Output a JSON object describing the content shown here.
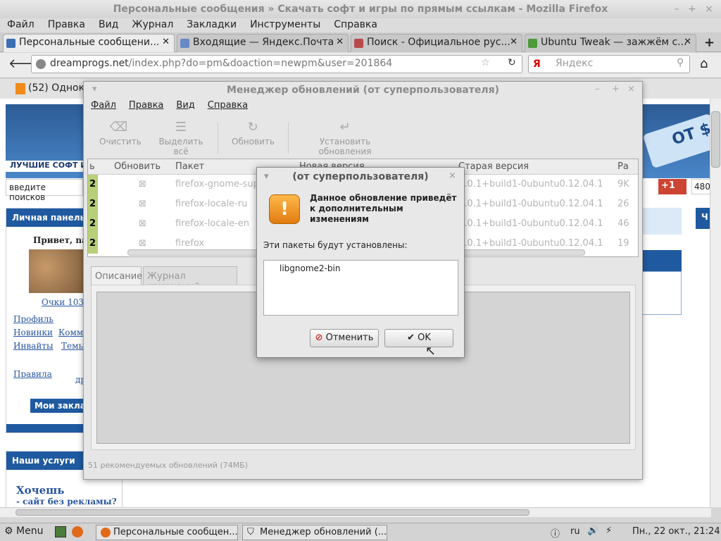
{
  "firefox": {
    "window_title": "Персональные сообщения » Скачать софт и игры по прямым ссылкам - Mozilla Firefox",
    "menu": [
      "Файл",
      "Правка",
      "Вид",
      "Журнал",
      "Закладки",
      "Инструменты",
      "Справка"
    ],
    "tabs": [
      {
        "label": "Персональные сообщени...",
        "active": true
      },
      {
        "label": "Входящие — Яндекс.Почта",
        "active": false
      },
      {
        "label": "Поиск - Официальное рус...",
        "active": false
      },
      {
        "label": "Ubuntu Tweak — зажжём с...",
        "active": false
      }
    ],
    "url_host": "dreamprogs.net",
    "url_path": "/index.php?do=pm&doaction=newpm&user=201864",
    "search_placeholder": "Яндекс",
    "bookmark": "(52) Однокл"
  },
  "page": {
    "header_tag": "ЛУЧШИЕ СОФТ И",
    "search_placeholder": "введите поисков",
    "badge_text": "OT $",
    "social_plus": "+1",
    "social_count": "480",
    "panel_title": "Личная панель",
    "greeting": "Привет, nayc",
    "glasses": "Очки 10378",
    "links": [
      "Профиль",
      "Новинки",
      "Комме",
      "Инвайты",
      "Темы",
      "Правила",
      "др"
    ],
    "bookmarks_btn": "Мои заклад",
    "services_title": "Наши услуги",
    "promo_title": "Хочешь",
    "promo_sub": "- сайт без рекламы?",
    "right_panel": "Ч"
  },
  "updater": {
    "title": "Менеджер обновлений (от суперпользователя)",
    "menu": [
      "Файл",
      "Правка",
      "Вид",
      "Справка"
    ],
    "toolbar": [
      "Очистить",
      "Выделить всё",
      "Обновить",
      "Установить обновления"
    ],
    "columns": [
      "ь",
      "Обновить",
      "Пакет",
      "Новая версия",
      "Старая версия",
      "Ра"
    ],
    "rows": [
      {
        "mark": "2",
        "package": "firefox-gnome-supp",
        "old": "5.0.1+build1-0ubuntu0.12.04.1",
        "size": "9K"
      },
      {
        "mark": "2",
        "package": "firefox-locale-ru",
        "old": "5.0.1+build1-0ubuntu0.12.04.1",
        "size": "26"
      },
      {
        "mark": "2",
        "package": "firefox-locale-en",
        "old": "5.0.1+build1-0ubuntu0.12.04.1",
        "size": "46"
      },
      {
        "mark": "2",
        "package": "firefox",
        "old": "5.0.1+build1-0ubuntu0.12.04.1",
        "size": "19"
      }
    ],
    "inner_tabs": [
      "Описание",
      "Журнал изменений"
    ],
    "status": "51 рекомендуемых обновлений (74МБ)"
  },
  "dialog": {
    "title": "(от суперпользователя)",
    "message": "Данное обновление приведёт к дополнительным изменениям",
    "subtitle": "Эти пакеты будут установлены:",
    "packages": [
      "libgnome2-bin"
    ],
    "cancel": "Отменить",
    "ok": "OK"
  },
  "taskbar": {
    "menu": "Menu",
    "tasks": [
      "Персональные сообщен...",
      "Менеджер обновлений (..."
    ],
    "lang": "ru",
    "clock": "Пн., 22 окт., 21:24"
  }
}
